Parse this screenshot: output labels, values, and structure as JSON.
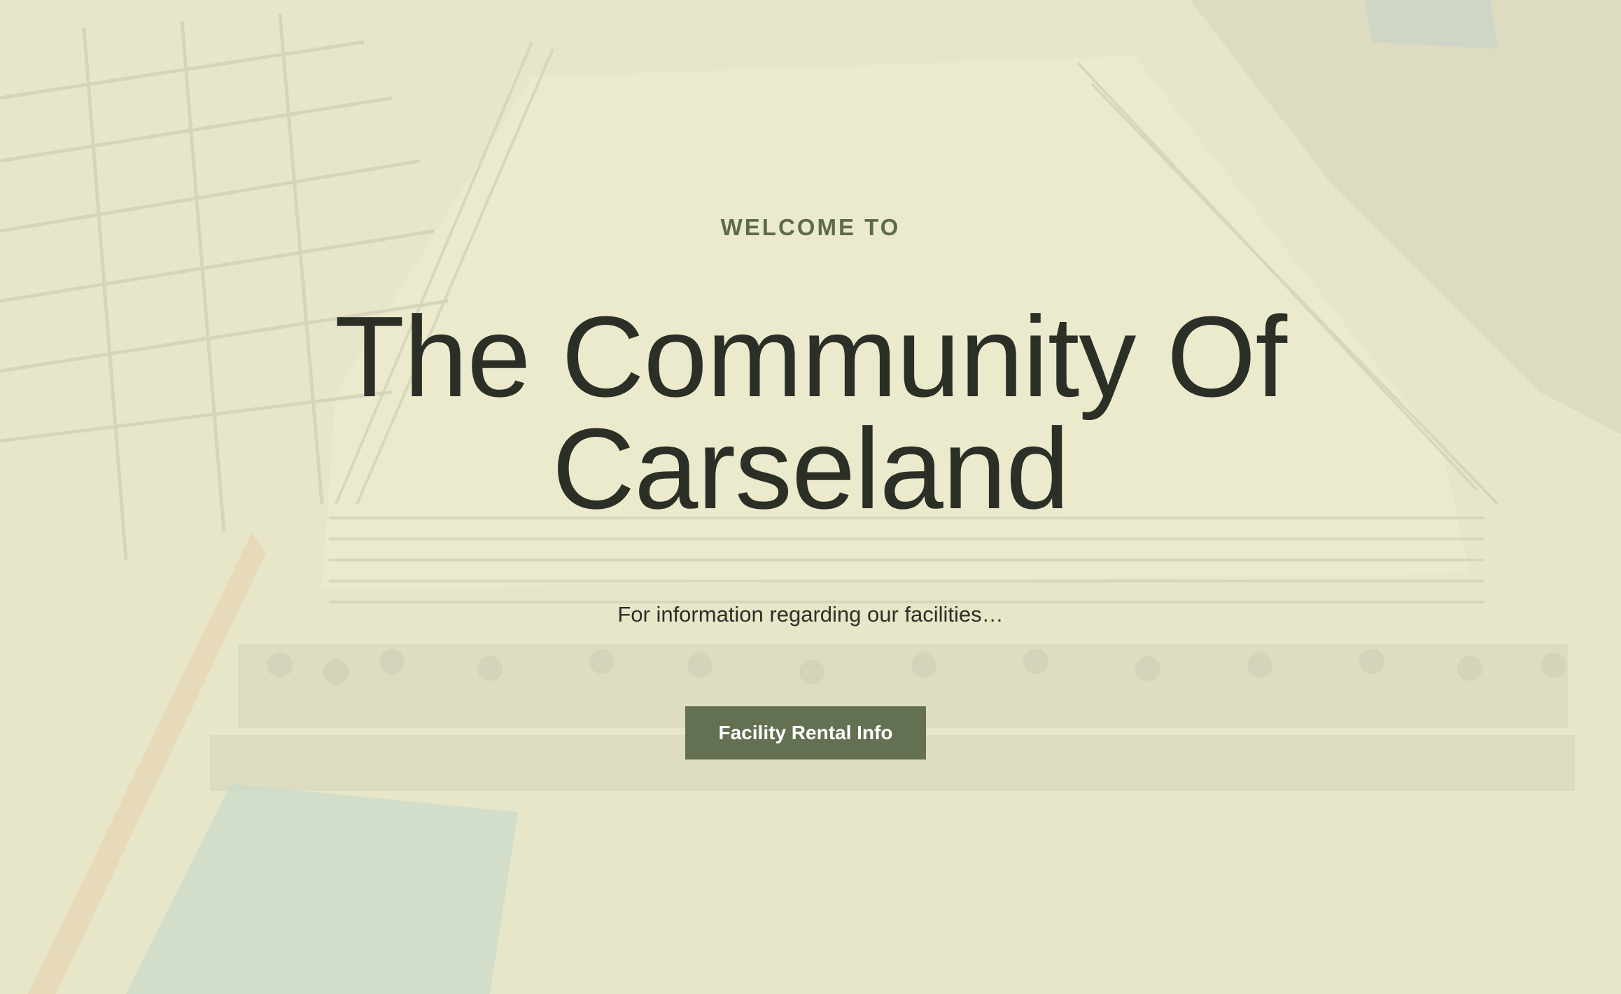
{
  "hero": {
    "eyebrow": "WELCOME TO",
    "title": "The Community Of Carseland",
    "subtitle": "For information regarding our facilities…",
    "cta_label": "Facility Rental Info"
  },
  "colors": {
    "overlay": "#f4f2d7",
    "eyebrow": "#5d6a4c",
    "title": "#2c2f26",
    "button": "#637051",
    "button_text": "#ffffff"
  },
  "background": {
    "description_icon": "rodeo-arena-photo"
  }
}
